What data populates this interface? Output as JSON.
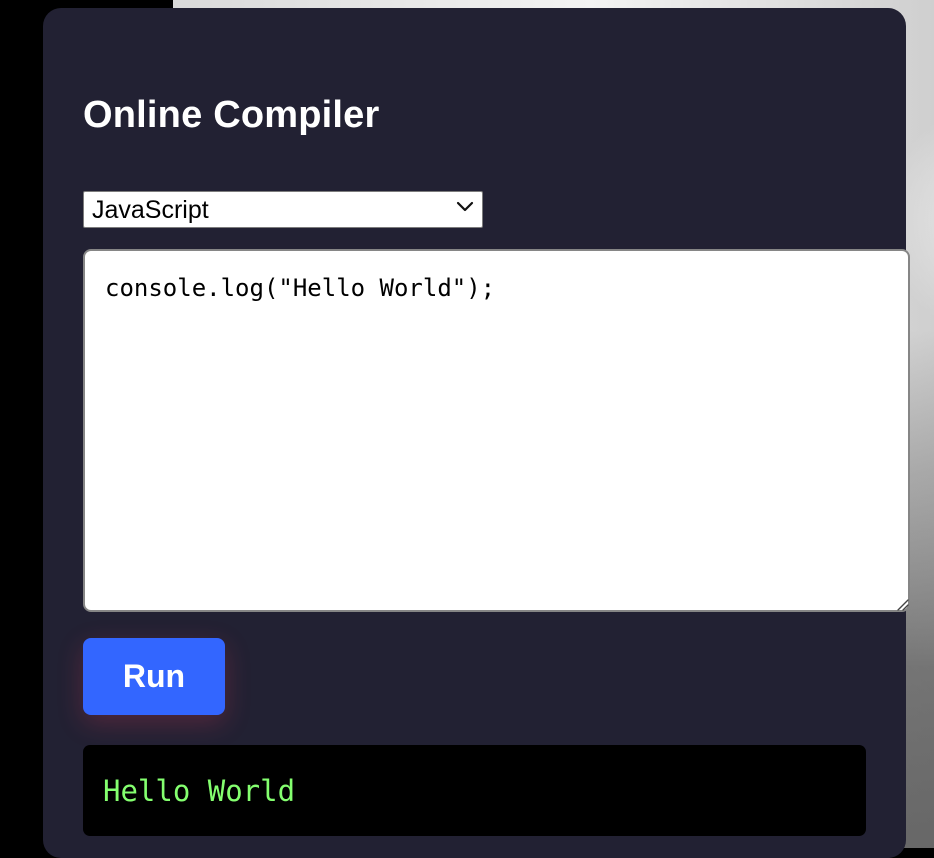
{
  "page": {
    "title": "Online Compiler"
  },
  "compiler": {
    "language": "JavaScript",
    "code": "console.log(\"Hello World\");",
    "run_label": "Run",
    "output": "Hello World"
  },
  "icons": {
    "select_chevron": "chevron-down-icon",
    "editor_resize": "resize-grip-icon"
  },
  "colors": {
    "card_background": "#222133",
    "run_button": "#3366ff",
    "output_text": "#84ff6f"
  }
}
